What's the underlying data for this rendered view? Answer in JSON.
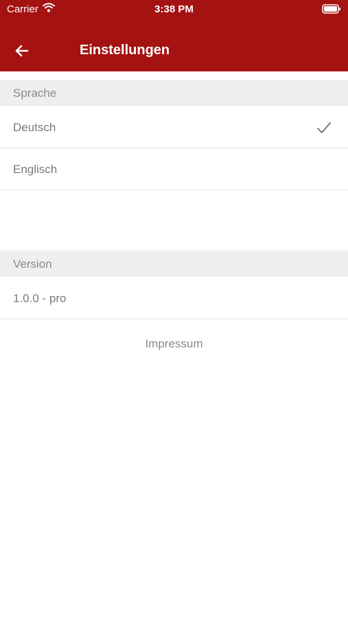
{
  "status": {
    "carrier": "Carrier",
    "time": "3:38 PM"
  },
  "nav": {
    "title": "Einstellungen",
    "back_icon": "arrow-left-icon"
  },
  "language": {
    "header": "Sprache",
    "options": [
      {
        "label": "Deutsch",
        "selected": true
      },
      {
        "label": "Englisch",
        "selected": false
      }
    ]
  },
  "version": {
    "header": "Version",
    "value": "1.0.0 - pro"
  },
  "links": {
    "impressum": "Impressum"
  },
  "colors": {
    "accent": "#a51212",
    "section_bg": "#efefef"
  }
}
